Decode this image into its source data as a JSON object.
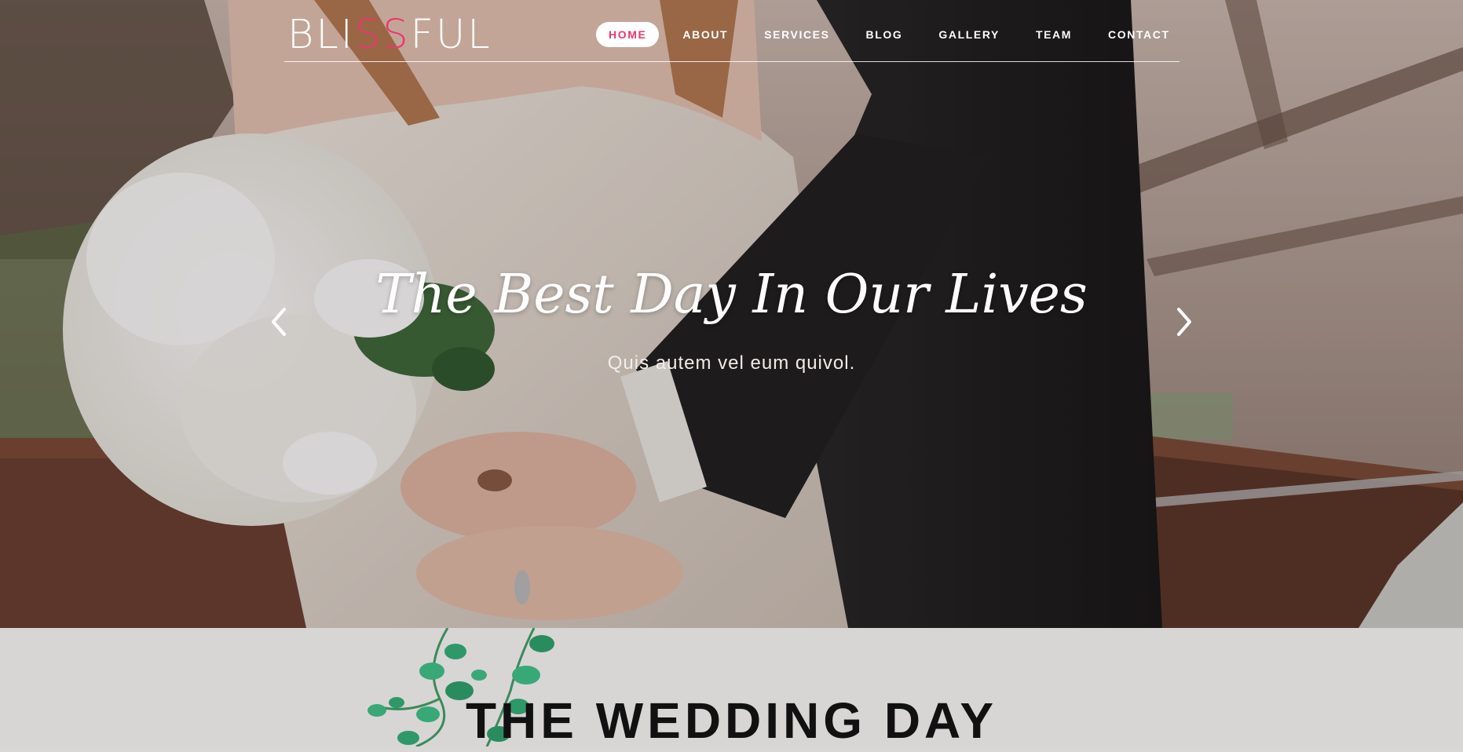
{
  "brand": {
    "logo_part1": "BLI",
    "logo_accent": "SS",
    "logo_part2": "FUL",
    "accent_color": "#e8386d"
  },
  "nav": {
    "items": [
      {
        "label": "HOME",
        "active": true
      },
      {
        "label": "ABOUT",
        "active": false
      },
      {
        "label": "SERVICES",
        "active": false
      },
      {
        "label": "BLOG",
        "active": false
      },
      {
        "label": "GALLERY",
        "active": false
      },
      {
        "label": "TEAM",
        "active": false
      },
      {
        "label": "CONTACT",
        "active": false
      }
    ]
  },
  "hero": {
    "title": "The Best Day In Our Lives",
    "subtitle": "Quis autem vel eum quivol.",
    "prev_icon": "chevron-left-icon",
    "next_icon": "chevron-right-icon",
    "image": "wedding-couple-photo"
  },
  "section": {
    "heading": "THE WEDDING DAY",
    "decor": "green-vine-leaves"
  }
}
